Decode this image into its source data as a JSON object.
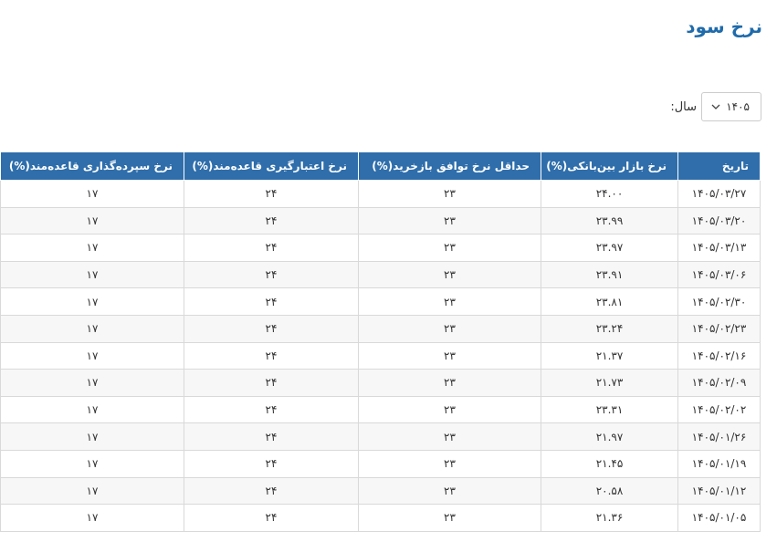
{
  "page": {
    "title": "نرخ سود"
  },
  "filter": {
    "year_label": "سال:",
    "year_value": "۱۴۰۵"
  },
  "table": {
    "headers": {
      "date": "تاریخ",
      "interbank": "نرخ بازار بین‌بانکی(%)",
      "repo_min": "حداقل نرخ توافق بازخرید(%)",
      "credit_facility": "نرخ اعتبارگیری قاعده‌مند(%)",
      "deposit_facility": "نرخ سپرده‌گذاری قاعده‌مند(%)"
    },
    "rows": [
      {
        "date": "۱۴۰۵/۰۳/۲۷",
        "interbank": "۲۴.۰۰",
        "repo_min": "۲۳",
        "credit_facility": "۲۴",
        "deposit_facility": "۱۷"
      },
      {
        "date": "۱۴۰۵/۰۳/۲۰",
        "interbank": "۲۳.۹۹",
        "repo_min": "۲۳",
        "credit_facility": "۲۴",
        "deposit_facility": "۱۷"
      },
      {
        "date": "۱۴۰۵/۰۳/۱۳",
        "interbank": "۲۳.۹۷",
        "repo_min": "۲۳",
        "credit_facility": "۲۴",
        "deposit_facility": "۱۷"
      },
      {
        "date": "۱۴۰۵/۰۳/۰۶",
        "interbank": "۲۳.۹۱",
        "repo_min": "۲۳",
        "credit_facility": "۲۴",
        "deposit_facility": "۱۷"
      },
      {
        "date": "۱۴۰۵/۰۲/۳۰",
        "interbank": "۲۳.۸۱",
        "repo_min": "۲۳",
        "credit_facility": "۲۴",
        "deposit_facility": "۱۷"
      },
      {
        "date": "۱۴۰۵/۰۲/۲۳",
        "interbank": "۲۳.۲۴",
        "repo_min": "۲۳",
        "credit_facility": "۲۴",
        "deposit_facility": "۱۷"
      },
      {
        "date": "۱۴۰۵/۰۲/۱۶",
        "interbank": "۲۱.۳۷",
        "repo_min": "۲۳",
        "credit_facility": "۲۴",
        "deposit_facility": "۱۷"
      },
      {
        "date": "۱۴۰۵/۰۲/۰۹",
        "interbank": "۲۱.۷۳",
        "repo_min": "۲۳",
        "credit_facility": "۲۴",
        "deposit_facility": "۱۷"
      },
      {
        "date": "۱۴۰۵/۰۲/۰۲",
        "interbank": "۲۳.۳۱",
        "repo_min": "۲۳",
        "credit_facility": "۲۴",
        "deposit_facility": "۱۷"
      },
      {
        "date": "۱۴۰۵/۰۱/۲۶",
        "interbank": "۲۱.۹۷",
        "repo_min": "۲۳",
        "credit_facility": "۲۴",
        "deposit_facility": "۱۷"
      },
      {
        "date": "۱۴۰۵/۰۱/۱۹",
        "interbank": "۲۱.۴۵",
        "repo_min": "۲۳",
        "credit_facility": "۲۴",
        "deposit_facility": "۱۷"
      },
      {
        "date": "۱۴۰۵/۰۱/۱۲",
        "interbank": "۲۰.۵۸",
        "repo_min": "۲۳",
        "credit_facility": "۲۴",
        "deposit_facility": "۱۷"
      },
      {
        "date": "۱۴۰۵/۰۱/۰۵",
        "interbank": "۲۱.۳۶",
        "repo_min": "۲۳",
        "credit_facility": "۲۴",
        "deposit_facility": "۱۷"
      }
    ]
  }
}
